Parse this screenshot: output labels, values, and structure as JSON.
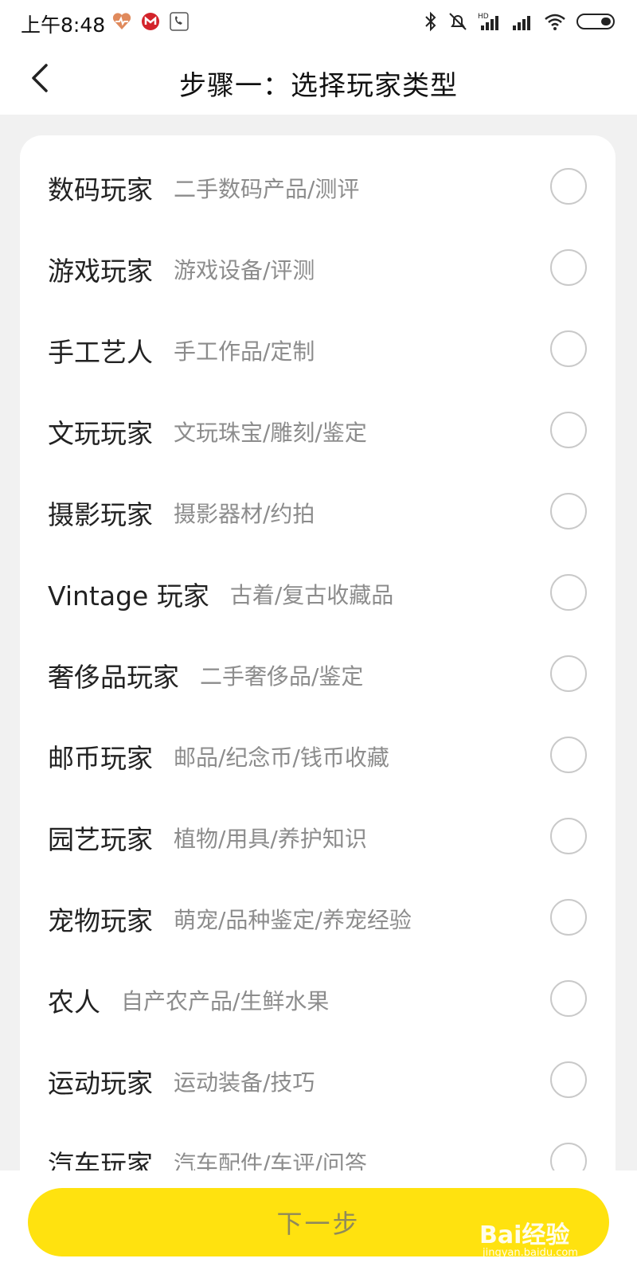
{
  "status_bar": {
    "time": "上午8:48",
    "left_icons": [
      "health-app-icon",
      "bank-app-icon",
      "phone-app-icon"
    ],
    "right_icons": [
      "bluetooth-icon",
      "mute-bell-icon",
      "hd-signal-icon",
      "signal-icon",
      "wifi-icon",
      "battery-icon"
    ]
  },
  "header": {
    "title": "步骤一：选择玩家类型"
  },
  "options": [
    {
      "title": "数码玩家",
      "desc": "二手数码产品/测评"
    },
    {
      "title": "游戏玩家",
      "desc": "游戏设备/评测"
    },
    {
      "title": "手工艺人",
      "desc": "手工作品/定制"
    },
    {
      "title": "文玩玩家",
      "desc": "文玩珠宝/雕刻/鉴定"
    },
    {
      "title": "摄影玩家",
      "desc": "摄影器材/约拍"
    },
    {
      "title": "Vintage 玩家",
      "desc": "古着/复古收藏品"
    },
    {
      "title": "奢侈品玩家",
      "desc": "二手奢侈品/鉴定"
    },
    {
      "title": "邮币玩家",
      "desc": "邮品/纪念币/钱币收藏"
    },
    {
      "title": "园艺玩家",
      "desc": "植物/用具/养护知识"
    },
    {
      "title": "宠物玩家",
      "desc": "萌宠/品种鉴定/养宠经验"
    },
    {
      "title": "农人",
      "desc": "自产农产品/生鲜水果"
    },
    {
      "title": "运动玩家",
      "desc": "运动装备/技巧"
    },
    {
      "title": "汽车玩家",
      "desc": "汽车配件/车评/问答"
    }
  ],
  "footer": {
    "next_label": "下一步"
  },
  "watermark": {
    "brand": "Bai经验",
    "url": "jingyan.baidu.com"
  },
  "colors": {
    "accent": "#ffe20f",
    "background": "#f1f1f1",
    "desc_text": "#8c8c8c"
  }
}
